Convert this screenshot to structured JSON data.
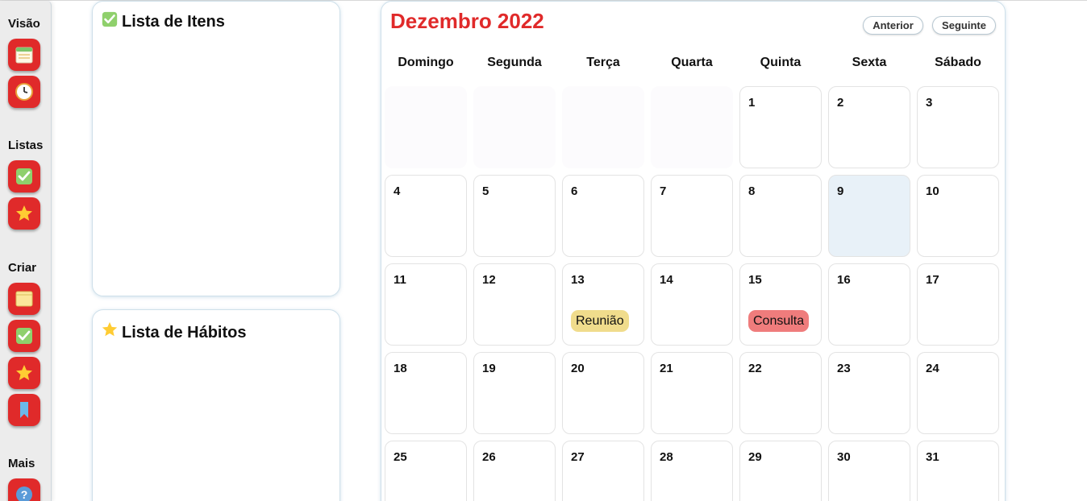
{
  "sidebar": {
    "sections": {
      "visao": "Visão",
      "listas": "Listas",
      "criar": "Criar",
      "mais": "Mais"
    },
    "button_color": "#e02a2a"
  },
  "panels": {
    "items": {
      "title": "Lista de Itens"
    },
    "habits": {
      "title": "Lista de Hábitos"
    }
  },
  "calendar": {
    "title": "Dezembro 2022",
    "prev_label": "Anterior",
    "next_label": "Seguinte",
    "title_color": "#e02a2a",
    "weekdays": [
      "Domingo",
      "Segunda",
      "Terça",
      "Quarta",
      "Quinta",
      "Sexta",
      "Sábado"
    ],
    "weeks": [
      [
        "",
        "",
        "",
        "",
        "1",
        "2",
        "3"
      ],
      [
        "4",
        "5",
        "6",
        "7",
        "8",
        "9",
        "10"
      ],
      [
        "11",
        "12",
        "13",
        "14",
        "15",
        "16",
        "17"
      ],
      [
        "18",
        "19",
        "20",
        "21",
        "22",
        "23",
        "24"
      ],
      [
        "25",
        "26",
        "27",
        "28",
        "29",
        "30",
        "31"
      ]
    ],
    "today": "9",
    "events": [
      {
        "day": "13",
        "label": "Reunião",
        "color": "#f0dc8c"
      },
      {
        "day": "15",
        "label": "Consulta",
        "color": "#ef7c7c"
      }
    ]
  }
}
